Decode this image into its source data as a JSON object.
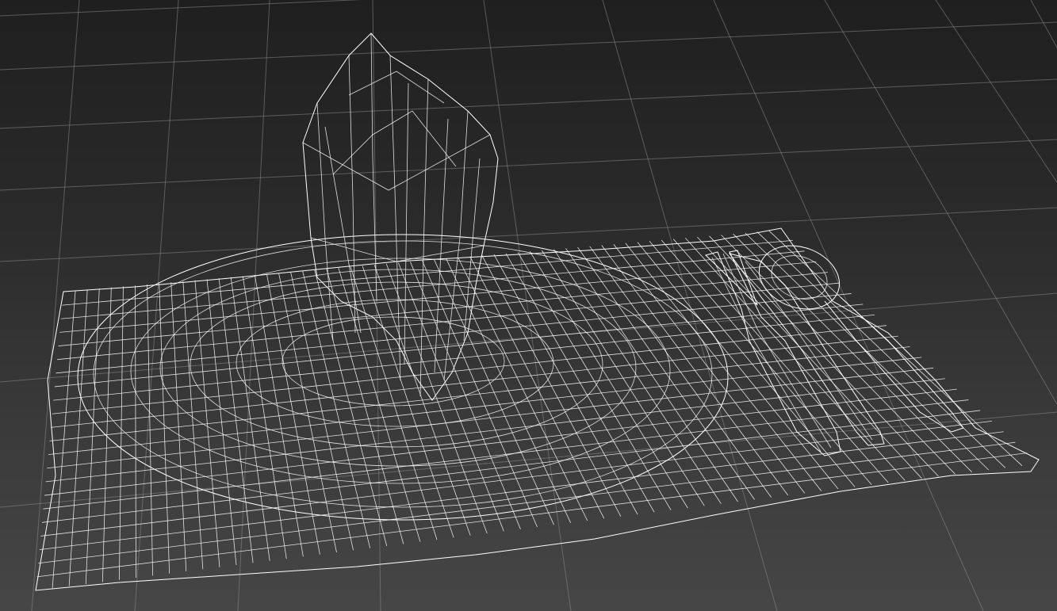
{
  "viewport": {
    "view_mode": "wireframe",
    "background_color": "#2f2f2f",
    "grid_color": "#8a8a8a",
    "wire_color": "#ffffff"
  },
  "scene": {
    "objects": [
      {
        "name": "placemat",
        "icon": "placemat-icon"
      },
      {
        "name": "plate",
        "icon": "plate-icon"
      },
      {
        "name": "folded-napkin",
        "icon": "napkin-icon"
      },
      {
        "name": "fork",
        "icon": "fork-icon"
      },
      {
        "name": "knife",
        "icon": "knife-icon"
      },
      {
        "name": "spoon",
        "icon": "spoon-icon"
      }
    ]
  }
}
